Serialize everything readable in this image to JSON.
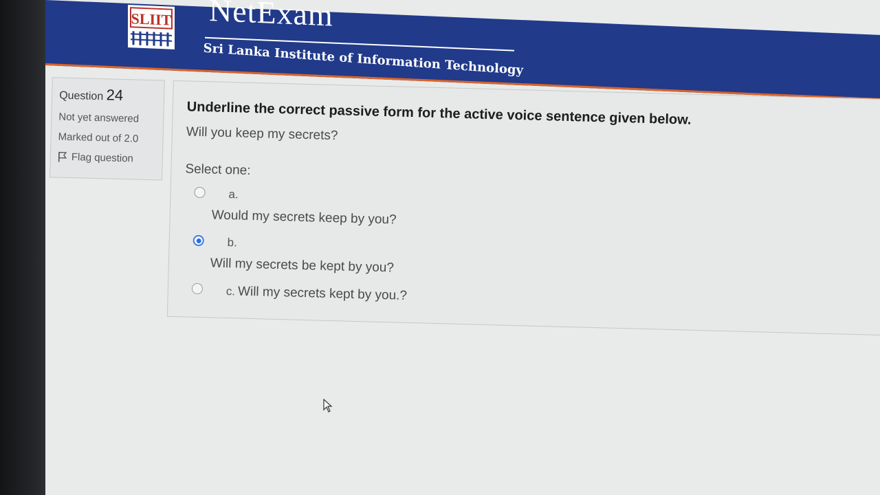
{
  "header": {
    "logo_text": "SLIIT",
    "brand_title": "NetExam",
    "brand_subtitle": "Sri Lanka Institute of Information Technology",
    "colors": {
      "header_bg": "#213a8a",
      "accent_line": "#d9652b"
    }
  },
  "question_info": {
    "label": "Question",
    "number": "24",
    "status": "Not yet answered",
    "marks": "Marked out of 2.0",
    "flag_label": "Flag question",
    "flag_icon": "flag-icon"
  },
  "question": {
    "prompt": "Underline the correct passive form for the active voice sentence given below.",
    "sentence": "Will you keep my secrets?",
    "select_label": "Select one:",
    "options": [
      {
        "letter": "a.",
        "text": "Would my secrets keep by you?",
        "selected": false
      },
      {
        "letter": "b.",
        "text": "Will my secrets be kept by you?",
        "selected": true
      },
      {
        "letter": "c.",
        "text": "Will my secrets kept by you.?",
        "selected": false
      }
    ],
    "selected_color": "#2a6ee0"
  }
}
